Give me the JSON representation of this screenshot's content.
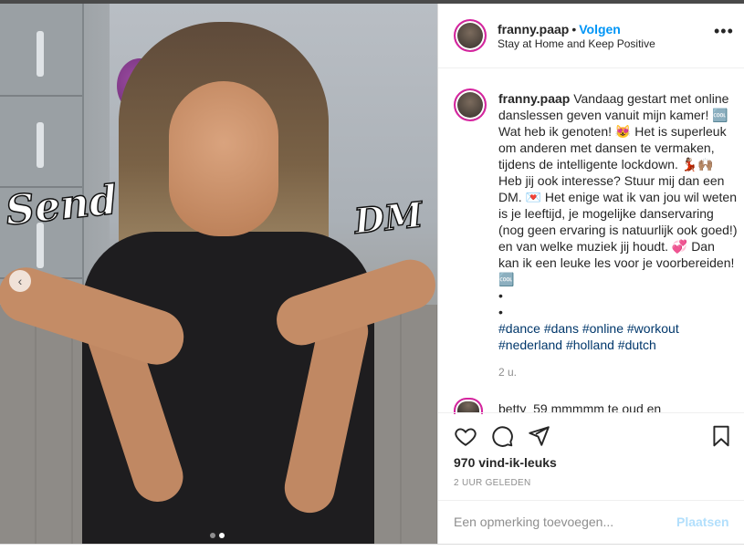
{
  "photo": {
    "overlay_left": "Send",
    "overlay_right": "DM",
    "carousel": {
      "count": 2,
      "active": 2
    }
  },
  "header": {
    "username": "franny.paap",
    "separator": "•",
    "follow_label": "Volgen",
    "subtitle": "Stay at Home and Keep Positive",
    "more_label": "•••"
  },
  "caption": {
    "username": "franny.paap",
    "text": " Vandaag gestart met online danslessen geven vanuit mijn kamer! 🆒 Wat heb ik genoten! 😻 Het is superleuk om anderen met dansen te vermaken, tijdens de intelligente lockdown. 💃🏽🙌🏽 Heb jij ook interesse? Stuur mij dan een DM. 💌 Het enige wat ik van jou wil weten is je leeftijd, je mogelijke danservaring (nog geen ervaring is natuurlijk ook goed!) en van welke muziek jij houdt. 💞 Dan kan ik een leuke les voor je voorbereiden! 🆒",
    "bullet1": "•",
    "bullet2": "•",
    "hashtags_line1": "#dance #dans #online #workout",
    "hashtags_line2": "#nederland #holland #dutch",
    "time": "2 u."
  },
  "comment_preview": "betty_59 mmmmm te oud en",
  "stats": {
    "likes": "970 vind-ik-leuks",
    "ago": "2 UUR GELEDEN"
  },
  "comment_box": {
    "placeholder": "Een opmerking toevoegen...",
    "post_label": "Plaatsen"
  },
  "colors": {
    "accent": "#0095f6",
    "post_disabled": "#b2dffc",
    "hashtag": "#00376b",
    "muted": "#8e8e8e"
  },
  "icons": [
    "heart-icon",
    "comment-icon",
    "share-icon",
    "bookmark-icon",
    "chevron-left-icon",
    "more-icon"
  ]
}
